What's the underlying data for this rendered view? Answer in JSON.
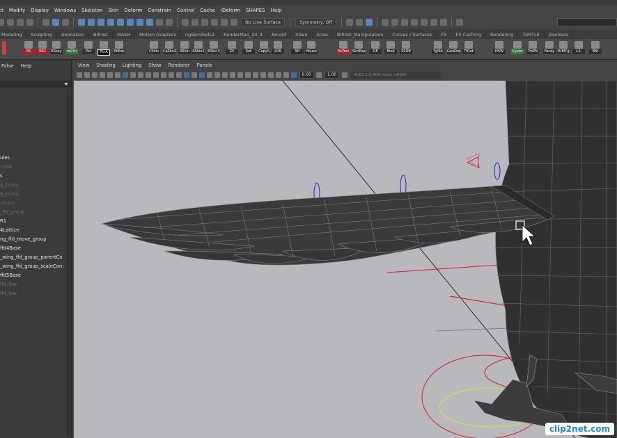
{
  "title_strip": "",
  "menubar": {
    "items": [
      "ect",
      "Modify",
      "Display",
      "Windows",
      "Skeleton",
      "Skin",
      "Deform",
      "Constrain",
      "Control",
      "Cache",
      "iDeform",
      "SHAPES",
      "Help"
    ]
  },
  "statusline": {
    "live_surface": "No Live Surface",
    "symmetry": "Symmetry: Off"
  },
  "shelf_tabs": [
    "y Modeling",
    "Sculpting",
    "Animation",
    "Bifrost",
    "MASH",
    "Motion Graphics",
    "ngSkinTools2",
    "RenderMan_24_4",
    "Arnold",
    "XGen",
    "Arise",
    "Bifrost_Manipulators",
    "Curves / Surfaces",
    "FX",
    "FX Caching",
    "Rendering",
    "TURTLE",
    "ZooTools"
  ],
  "shelf_buttons": [
    {
      "label": "RS",
      "style": "red"
    },
    {
      "label": "RS2",
      "style": "red"
    },
    {
      "label": "RSkey",
      "style": ""
    },
    {
      "label": "mCtrl",
      "style": "green"
    },
    {
      "label": "Pkr",
      "style": ""
    },
    {
      "label": "PkrA",
      "style": "white"
    },
    {
      "label": "PkExp",
      "style": ""
    },
    {
      "label": "CSkin",
      "style": ""
    },
    {
      "label": "CpSkn2",
      "style": ""
    },
    {
      "label": "RSkin",
      "style": ""
    },
    {
      "label": "RSkin2",
      "style": ""
    },
    {
      "label": "RSkin3",
      "style": ""
    },
    {
      "label": "ZV",
      "style": ""
    },
    {
      "label": "Set",
      "style": ""
    },
    {
      "label": "CopyS",
      "style": ""
    },
    {
      "label": "LRA",
      "style": ""
    },
    {
      "label": "SH",
      "style": ""
    },
    {
      "label": "House",
      "style": ""
    },
    {
      "label": "PxTool",
      "style": "red"
    },
    {
      "label": "SknExp",
      "style": ""
    },
    {
      "label": "GE",
      "style": ""
    },
    {
      "label": "Bind",
      "style": ""
    },
    {
      "label": "SSOff",
      "style": ""
    },
    {
      "label": "TglSh",
      "style": ""
    },
    {
      "label": "GeoOut",
      "style": ""
    },
    {
      "label": "TrOut",
      "style": ""
    },
    {
      "label": "HSW",
      "style": ""
    },
    {
      "label": "Cycler",
      "style": "green"
    },
    {
      "label": "TrsEN",
      "style": ""
    },
    {
      "label": "Facey",
      "style": ""
    },
    {
      "label": "M-BITg",
      "style": ""
    },
    {
      "label": "L-L",
      "style": ""
    },
    {
      "label": "BSt",
      "style": ""
    }
  ],
  "outliner": {
    "menu": [
      "False",
      "Help"
    ],
    "items": [
      {
        "label": "ules",
        "dim": false
      },
      {
        "label": "ction",
        "dim": true
      },
      {
        "label": "s",
        "dim": false
      },
      {
        "label": "g_proxy",
        "dim": true
      },
      {
        "label": "g_proxy",
        "dim": true
      },
      {
        "label": "ystem",
        "dim": true
      },
      {
        "label": "_ffd_group",
        "dim": true
      },
      {
        "label": "R1",
        "dim": false
      },
      {
        "label": "4Lattice",
        "dim": false
      },
      {
        "label": "ng_ffd_move_group",
        "dim": false
      },
      {
        "label": "ffd4Base",
        "dim": false
      },
      {
        "label": "_wing_ffd_group_parentCo",
        "dim": false
      },
      {
        "label": "_wing_ffd_group_scaleCon:",
        "dim": false
      },
      {
        "label": "ffd5Base",
        "dim": false
      },
      {
        "label": "ffd_low",
        "dim": true
      },
      {
        "label": "ffd_low",
        "dim": true
      }
    ]
  },
  "viewport": {
    "menu": [
      "View",
      "Shading",
      "Lighting",
      "Show",
      "Renderer",
      "Panels"
    ],
    "field1": "0.00",
    "field2": "1.00",
    "colorspace": "ACES 1.0 SDR-video (sRGB)"
  },
  "watermark": "clip2net.com",
  "colors": {
    "viewport_bg": "#b9b8bc",
    "mesh_dark": "#2f2f2f",
    "curve_yellow": "#e8e020",
    "curve_red": "#d02030",
    "curve_blue": "#2020d0",
    "curve_cyan": "#30c8e0"
  }
}
